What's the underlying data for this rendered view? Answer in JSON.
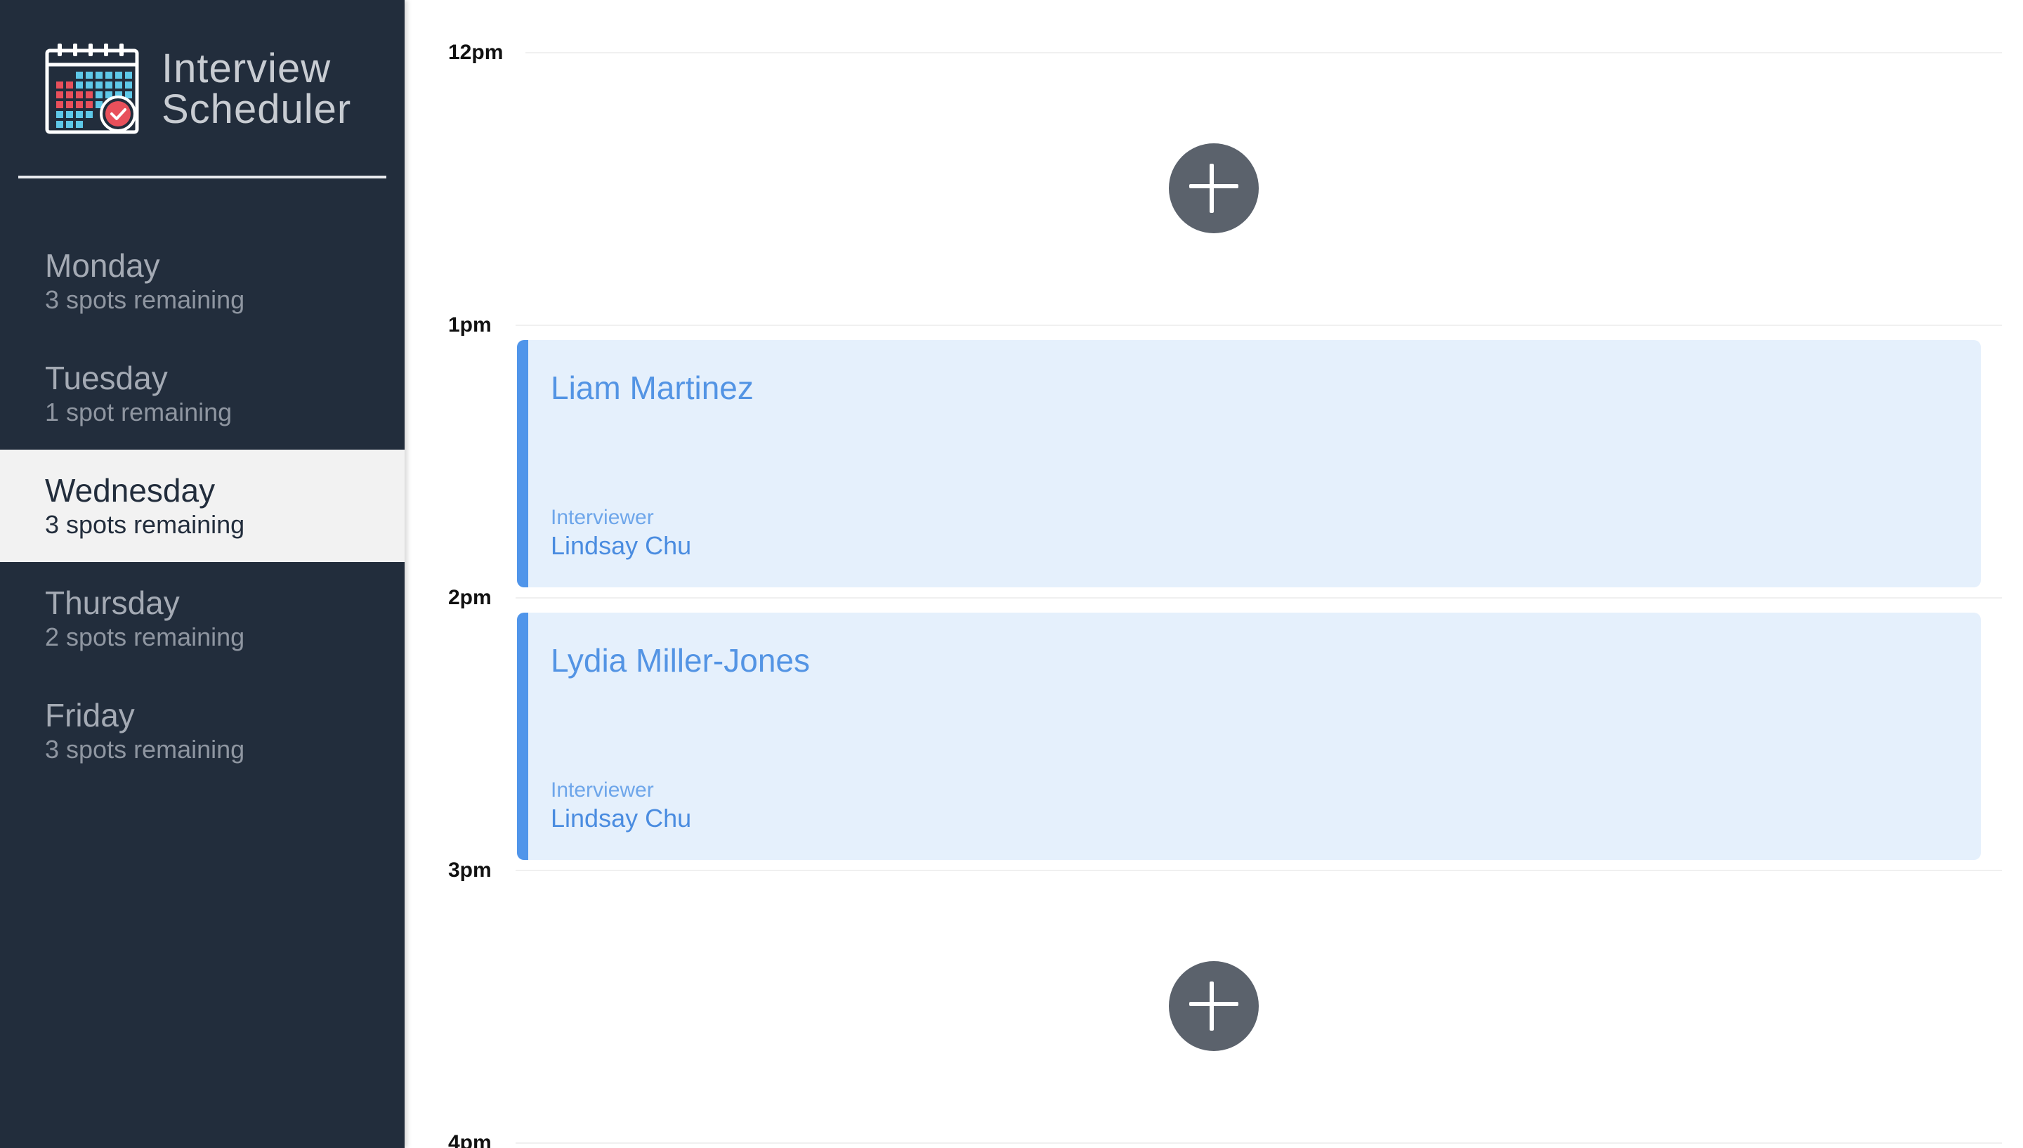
{
  "app": {
    "title_line1": "Interview",
    "title_line2": "Scheduler"
  },
  "sidebar": {
    "days": [
      {
        "name": "Monday",
        "spots": "3 spots remaining",
        "selected": false
      },
      {
        "name": "Tuesday",
        "spots": "1 spot remaining",
        "selected": false
      },
      {
        "name": "Wednesday",
        "spots": "3 spots remaining",
        "selected": true
      },
      {
        "name": "Thursday",
        "spots": "2 spots remaining",
        "selected": false
      },
      {
        "name": "Friday",
        "spots": "3 spots remaining",
        "selected": false
      }
    ]
  },
  "schedule": {
    "slots": [
      {
        "time": "12pm",
        "appointment": null
      },
      {
        "time": "1pm",
        "appointment": {
          "student": "Liam Martinez",
          "interviewer_label": "Interviewer",
          "interviewer": "Lindsay Chu"
        }
      },
      {
        "time": "2pm",
        "appointment": {
          "student": "Lydia Miller-Jones",
          "interviewer_label": "Interviewer",
          "interviewer": "Lindsay Chu"
        }
      },
      {
        "time": "3pm",
        "appointment": null
      },
      {
        "time": "4pm",
        "appointment": null
      }
    ]
  },
  "colors": {
    "sidebar_bg": "#222d3c",
    "selected_bg": "#f2f2f2",
    "appointment_bg": "#e5f0fc",
    "appointment_accent": "#5095ea",
    "add_button": "#5b626c"
  },
  "icons": {
    "logo": "calendar-check-icon",
    "add": "plus-icon"
  }
}
